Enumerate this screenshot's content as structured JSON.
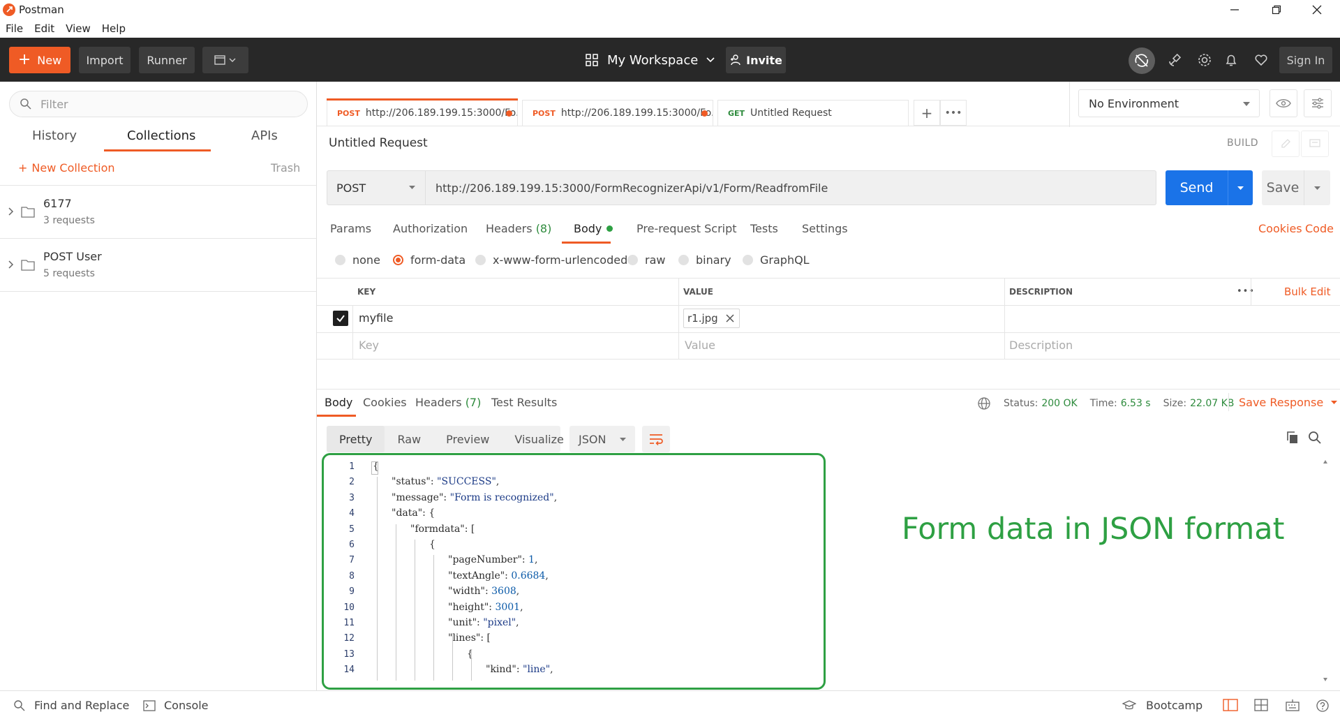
{
  "window": {
    "title": "Postman",
    "menu": [
      "File",
      "Edit",
      "View",
      "Help"
    ]
  },
  "header": {
    "new_label": "New",
    "import_label": "Import",
    "runner_label": "Runner",
    "workspace_label": "My Workspace",
    "invite_label": "Invite",
    "signin_label": "Sign In"
  },
  "sidebar": {
    "filter_placeholder": "Filter",
    "tabs": [
      "History",
      "Collections",
      "APIs"
    ],
    "active_tab": "Collections",
    "new_collection_label": "New Collection",
    "trash_label": "Trash",
    "collections": [
      {
        "name": "6177",
        "count": "3 requests"
      },
      {
        "name": "POST User",
        "count": "5 requests"
      }
    ]
  },
  "request_tabs": [
    {
      "method": "POST",
      "url": "http://206.189.199.15:3000/Fo...",
      "unsaved": true,
      "method_color": "#ef5b25"
    },
    {
      "method": "POST",
      "url": "http://206.189.199.15:3000/Fo...",
      "unsaved": true,
      "method_color": "#ef5b25"
    },
    {
      "method": "GET",
      "url": "Untitled Request",
      "unsaved": false,
      "method_color": "#2e8b3d"
    }
  ],
  "environment": {
    "selected": "No Environment"
  },
  "request": {
    "title": "Untitled Request",
    "build_label": "BUILD",
    "method": "POST",
    "url": "http://206.189.199.15:3000/FormRecognizerApi/v1/Form/ReadfromFile",
    "send_label": "Send",
    "save_label": "Save",
    "tabs": {
      "params": "Params",
      "authorization": "Authorization",
      "headers": "Headers",
      "headers_count": "(8)",
      "body": "Body",
      "prerequest": "Pre-request Script",
      "tests": "Tests",
      "settings": "Settings"
    },
    "cookies_label": "Cookies",
    "code_label": "Code",
    "body_types": [
      "none",
      "form-data",
      "x-www-form-urlencoded",
      "raw",
      "binary",
      "GraphQL"
    ],
    "body_type_selected": "form-data",
    "table": {
      "headers": [
        "KEY",
        "VALUE",
        "DESCRIPTION"
      ],
      "bulk_edit_label": "Bulk Edit",
      "rows": [
        {
          "key": "myfile",
          "value": "r1.jpg",
          "description": "",
          "checked": true
        }
      ],
      "placeholders": {
        "key": "Key",
        "value": "Value",
        "description": "Description"
      }
    }
  },
  "response": {
    "tabs": {
      "body": "Body",
      "cookies": "Cookies",
      "headers": "Headers",
      "headers_count": "(7)",
      "test_results": "Test Results"
    },
    "status_label": "Status:",
    "status_value": "200 OK",
    "time_label": "Time:",
    "time_value": "6.53 s",
    "size_label": "Size:",
    "size_value": "22.07 KB",
    "save_response_label": "Save Response",
    "formats": [
      "Pretty",
      "Raw",
      "Preview",
      "Visualize"
    ],
    "format_selected": "Pretty",
    "language": "JSON",
    "code_lines": [
      {
        "n": "1",
        "text": "{"
      },
      {
        "n": "2",
        "text": "\"status\": \"SUCCESS\","
      },
      {
        "n": "3",
        "text": "\"message\": \"Form is recognized\","
      },
      {
        "n": "4",
        "text": "\"data\": {"
      },
      {
        "n": "5",
        "text": "\"formdata\": ["
      },
      {
        "n": "6",
        "text": "{"
      },
      {
        "n": "7",
        "text": "\"pageNumber\": 1,"
      },
      {
        "n": "8",
        "text": "\"textAngle\": 0.6684,"
      },
      {
        "n": "9",
        "text": "\"width\": 3608,"
      },
      {
        "n": "10",
        "text": "\"height\": 3001,"
      },
      {
        "n": "11",
        "text": "\"unit\": \"pixel\","
      },
      {
        "n": "12",
        "text": "\"lines\": ["
      },
      {
        "n": "13",
        "text": "{"
      },
      {
        "n": "14",
        "text": "\"kind\": \"line\","
      }
    ],
    "annotation": "Form data in JSON format"
  },
  "statusbar": {
    "find_replace": "Find and Replace",
    "console": "Console",
    "bootcamp": "Bootcamp"
  },
  "colors": {
    "accent": "#ef5b25",
    "send_blue": "#1a73e8",
    "success_green": "#2e8b3d",
    "annotation_green": "#2ea043",
    "header_dark": "#282828"
  }
}
